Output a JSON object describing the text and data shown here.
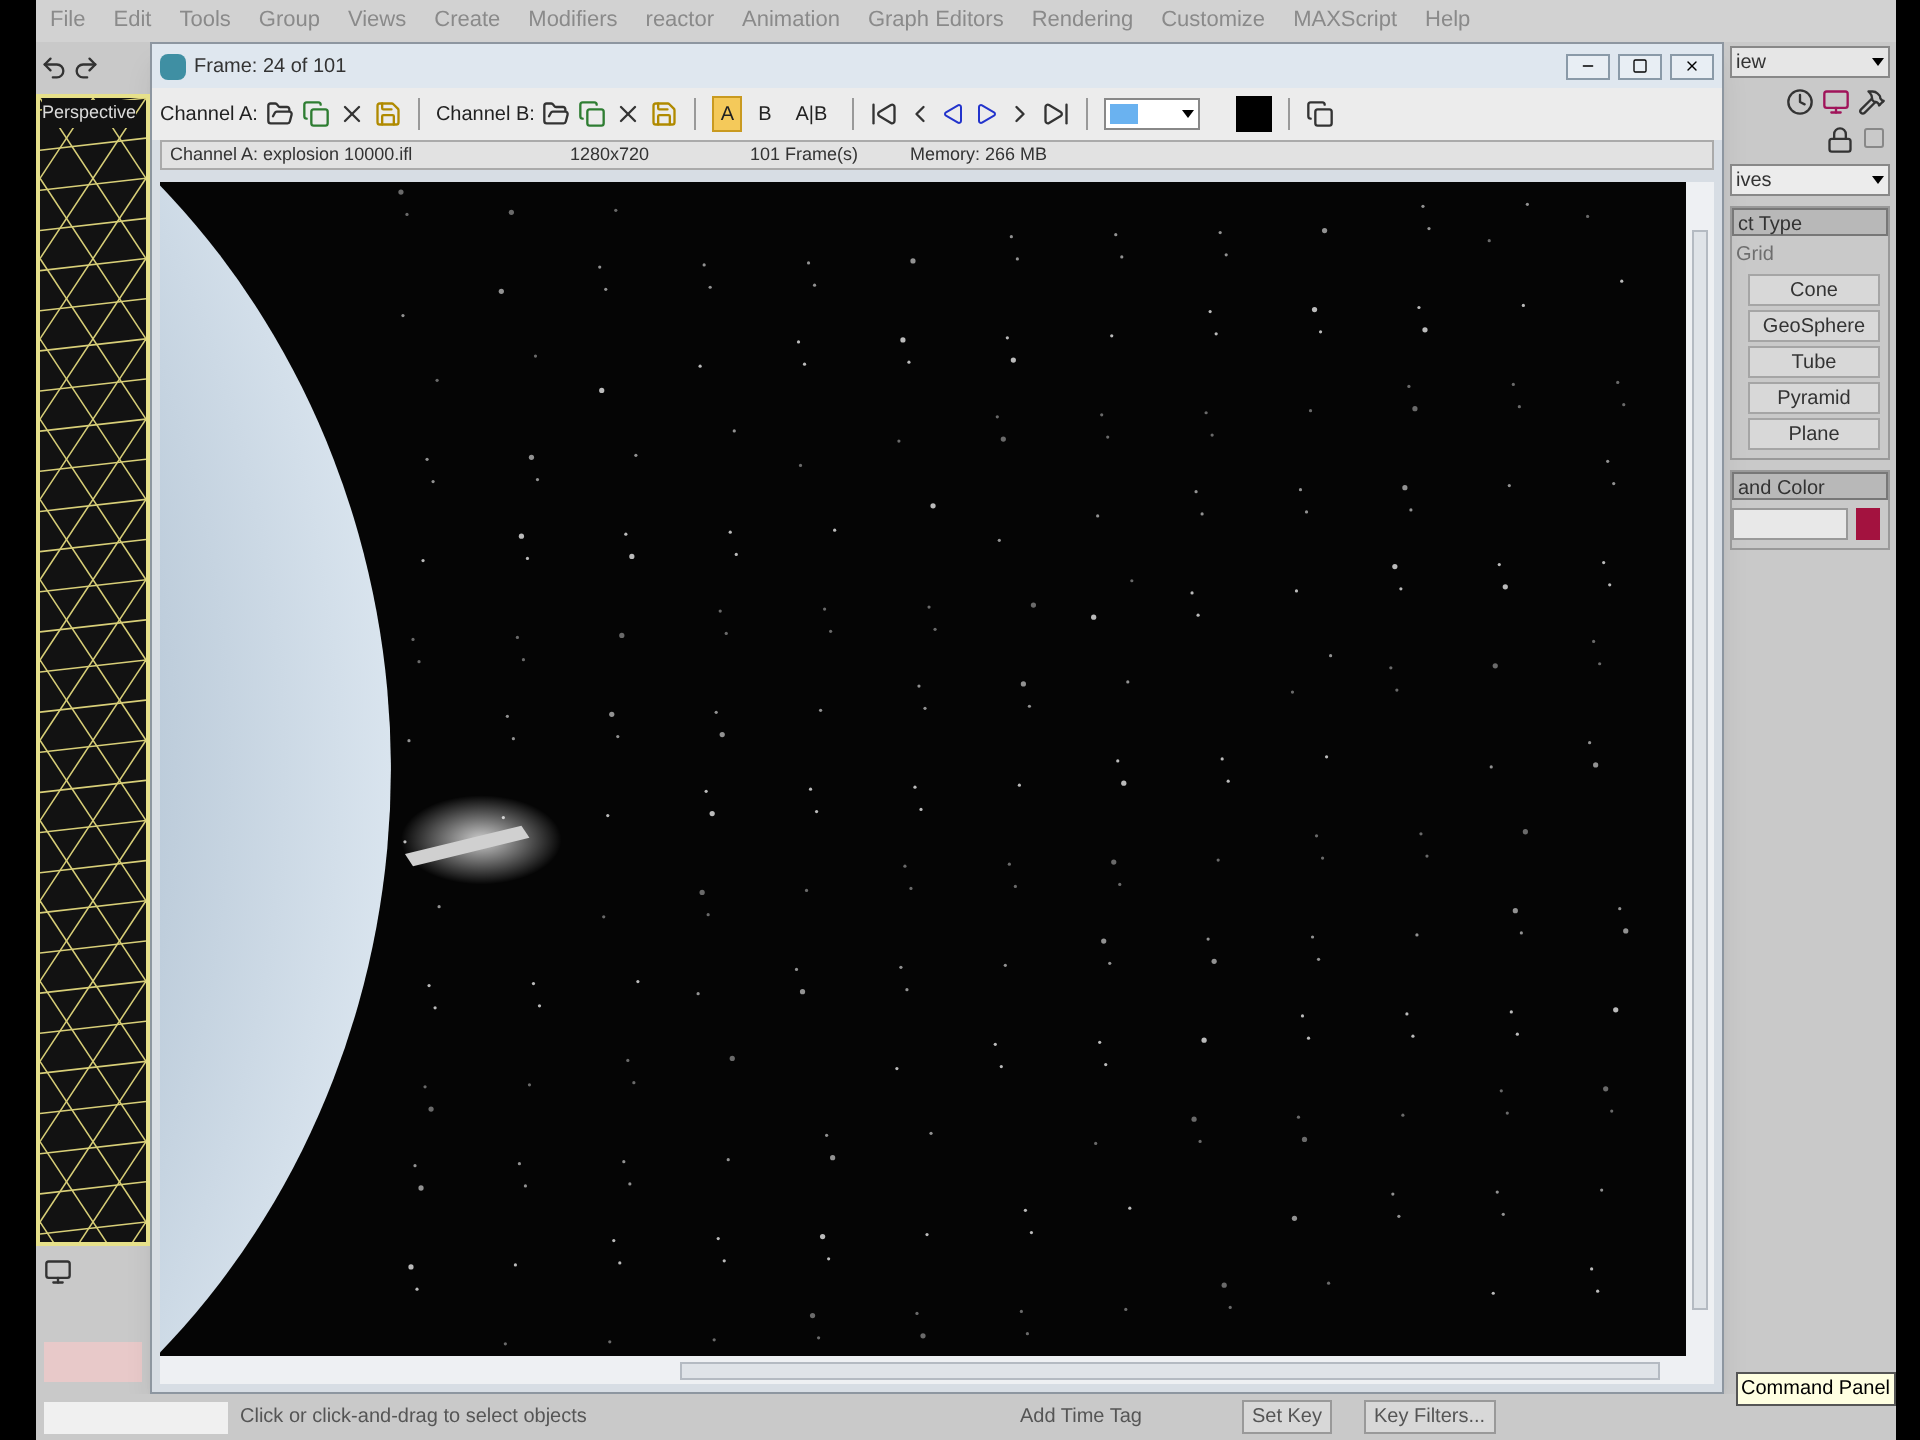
{
  "menu_bar": [
    "File",
    "Edit",
    "Tools",
    "Group",
    "Views",
    "Create",
    "Modifiers",
    "reactor",
    "Animation",
    "Graph Editors",
    "Rendering",
    "Customize",
    "MAXScript",
    "Help"
  ],
  "viewport": {
    "label": "Perspective"
  },
  "frame_window": {
    "title": "Frame: 24 of 101",
    "channel_a_label": "Channel A:",
    "channel_b_label": "Channel B:",
    "channel_buttons": [
      {
        "label": "A",
        "selected": true
      },
      {
        "label": "B",
        "selected": false
      },
      {
        "label": "A|B",
        "selected": false
      }
    ],
    "info": [
      "Channel A: explosion 10000.ifl",
      "1280x720",
      "101 Frame(s)",
      "Memory: 266 MB"
    ]
  },
  "command_panel": {
    "view_dropdown": "iew",
    "category_dropdown": "ives",
    "object_type_header": "ct Type",
    "autogrid": {
      "label": "Grid",
      "disabled": true
    },
    "buttons": [
      "Cone",
      "GeoSphere",
      "Tube",
      "Pyramid",
      "Plane"
    ],
    "name_color_header": "and Color",
    "color": "#a3123f"
  },
  "status_bar": {
    "prompt": "Click or click-and-drag to select objects",
    "add_time_tag": "Add Time Tag",
    "set_key": "Set Key",
    "key_filters": "Key Filters..."
  },
  "tooltip": "Command Panel"
}
